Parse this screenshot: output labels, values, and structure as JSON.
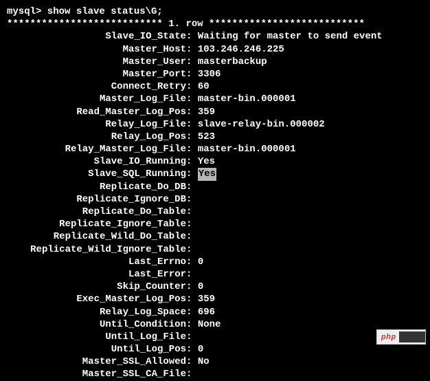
{
  "prompt": "mysql> show slave status\\G;",
  "row_header": "*************************** 1. row ***************************",
  "rows": [
    {
      "key": "Slave_IO_State",
      "value": "Waiting for master to send event",
      "highlight": false
    },
    {
      "key": "Master_Host",
      "value": "103.246.246.225",
      "highlight": false
    },
    {
      "key": "Master_User",
      "value": "masterbackup",
      "highlight": false
    },
    {
      "key": "Master_Port",
      "value": "3306",
      "highlight": false
    },
    {
      "key": "Connect_Retry",
      "value": "60",
      "highlight": false
    },
    {
      "key": "Master_Log_File",
      "value": "master-bin.000001",
      "highlight": false
    },
    {
      "key": "Read_Master_Log_Pos",
      "value": "359",
      "highlight": false
    },
    {
      "key": "Relay_Log_File",
      "value": "slave-relay-bin.000002",
      "highlight": false
    },
    {
      "key": "Relay_Log_Pos",
      "value": "523",
      "highlight": false
    },
    {
      "key": "Relay_Master_Log_File",
      "value": "master-bin.000001",
      "highlight": false
    },
    {
      "key": "Slave_IO_Running",
      "value": "Yes",
      "highlight": false
    },
    {
      "key": "Slave_SQL_Running",
      "value": "Yes",
      "highlight": true
    },
    {
      "key": "Replicate_Do_DB",
      "value": "",
      "highlight": false
    },
    {
      "key": "Replicate_Ignore_DB",
      "value": "",
      "highlight": false
    },
    {
      "key": "Replicate_Do_Table",
      "value": "",
      "highlight": false
    },
    {
      "key": "Replicate_Ignore_Table",
      "value": "",
      "highlight": false
    },
    {
      "key": "Replicate_Wild_Do_Table",
      "value": "",
      "highlight": false
    },
    {
      "key": "Replicate_Wild_Ignore_Table",
      "value": "",
      "highlight": false
    },
    {
      "key": "Last_Errno",
      "value": "0",
      "highlight": false
    },
    {
      "key": "Last_Error",
      "value": "",
      "highlight": false
    },
    {
      "key": "Skip_Counter",
      "value": "0",
      "highlight": false
    },
    {
      "key": "Exec_Master_Log_Pos",
      "value": "359",
      "highlight": false
    },
    {
      "key": "Relay_Log_Space",
      "value": "696",
      "highlight": false
    },
    {
      "key": "Until_Condition",
      "value": "None",
      "highlight": false
    },
    {
      "key": "Until_Log_File",
      "value": "",
      "highlight": false
    },
    {
      "key": "Until_Log_Pos",
      "value": "0",
      "highlight": false
    },
    {
      "key": "Master_SSL_Allowed",
      "value": "No",
      "highlight": false
    },
    {
      "key": "Master_SSL_CA_File",
      "value": "",
      "highlight": false
    }
  ],
  "watermark": {
    "text": "php"
  }
}
